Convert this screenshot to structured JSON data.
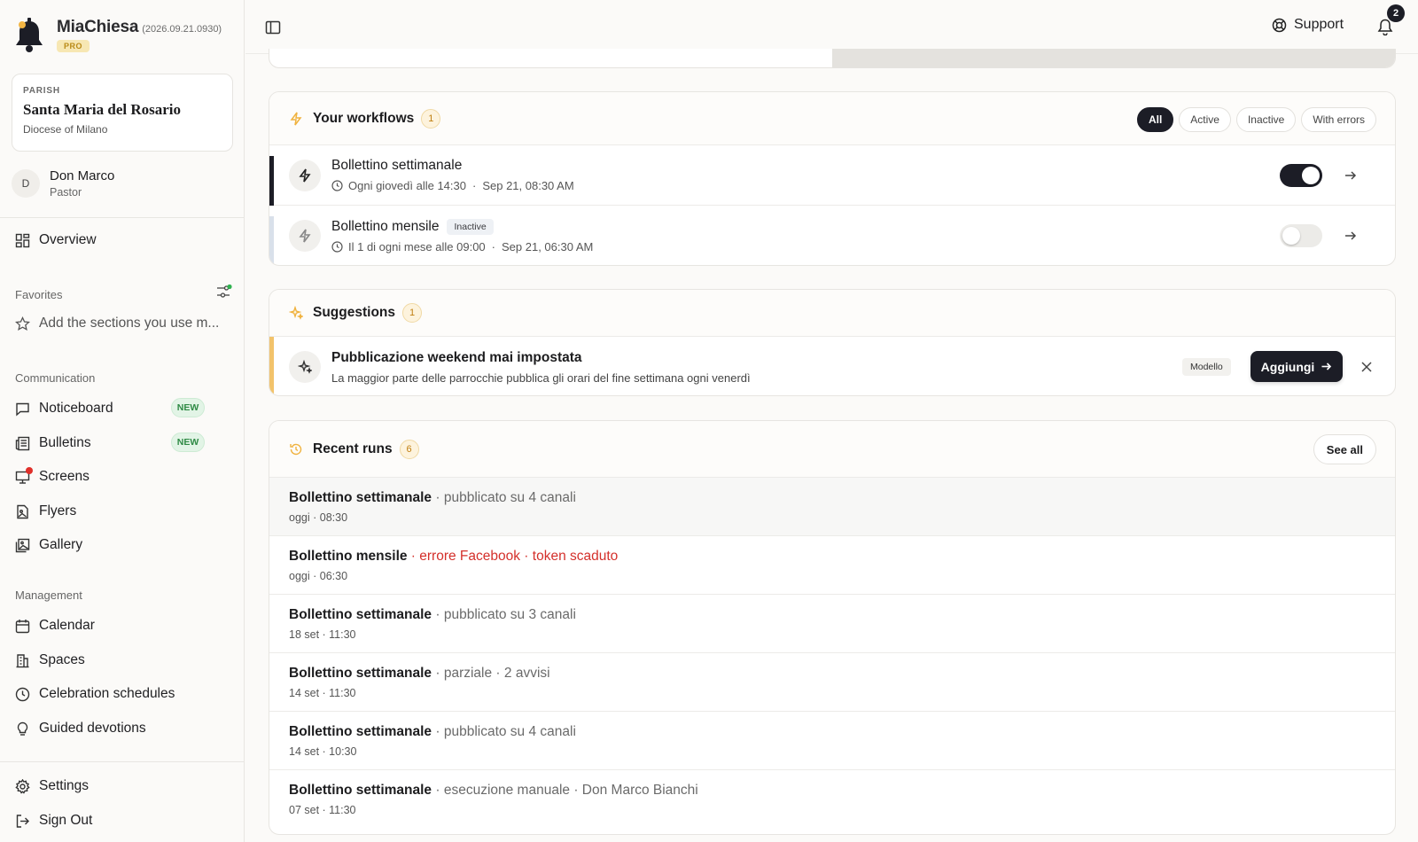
{
  "app": {
    "name": "MiaChiesa",
    "version": "(2026.09.21.0930)",
    "plan": "PRO"
  },
  "parish": {
    "kicker": "PARISH",
    "name": "Santa Maria del Rosario",
    "diocese": "Diocese of Milano"
  },
  "user": {
    "initial": "D",
    "name": "Don Marco",
    "role": "Pastor"
  },
  "nav": {
    "overview": "Overview",
    "favorites_label": "Favorites",
    "favorites_add": "Add the sections you use m...",
    "communication_label": "Communication",
    "noticeboard": "Noticeboard",
    "bulletins": "Bulletins",
    "screens": "Screens",
    "flyers": "Flyers",
    "gallery": "Gallery",
    "new_badge": "NEW",
    "management_label": "Management",
    "calendar": "Calendar",
    "spaces": "Spaces",
    "celebration": "Celebration schedules",
    "devotions": "Guided devotions",
    "settings": "Settings",
    "signout": "Sign Out"
  },
  "topbar": {
    "support": "Support",
    "notifications_count": "2"
  },
  "workflows": {
    "title": "Your workflows",
    "count": "1",
    "filters": [
      "All",
      "Active",
      "Inactive",
      "With errors"
    ],
    "active_filter": "All",
    "items": [
      {
        "name": "Bollettino settimanale",
        "schedule": "Ogni giovedì alle 14:30",
        "last": "Sep 21, 08:30 AM",
        "enabled": true,
        "status_label": ""
      },
      {
        "name": "Bollettino mensile",
        "schedule": "Il 1 di ogni mese alle 09:00",
        "last": "Sep 21, 06:30 AM",
        "enabled": false,
        "status_label": "Inactive"
      }
    ]
  },
  "suggestions": {
    "title": "Suggestions",
    "count": "1",
    "item": {
      "title": "Pubblicazione weekend mai impostata",
      "desc": "La maggior parte delle parrocchie pubblica gli orari del fine settimana ogni venerdì",
      "tag": "Modello",
      "action": "Aggiungi"
    }
  },
  "runs": {
    "title": "Recent runs",
    "count": "6",
    "see_all": "See all",
    "items": [
      {
        "name": "Bollettino settimanale",
        "detail": " · pubblicato su 4 canali",
        "time": "oggi · 08:30",
        "error": false
      },
      {
        "name": "Bollettino mensile",
        "detail": " · errore Facebook · token scaduto",
        "time": "oggi · 06:30",
        "error": true
      },
      {
        "name": "Bollettino settimanale",
        "detail": " · pubblicato su 3 canali",
        "time": "18 set · 11:30",
        "error": false
      },
      {
        "name": "Bollettino settimanale",
        "detail": " · parziale · 2 avvisi",
        "time": "14 set · 11:30",
        "error": false
      },
      {
        "name": "Bollettino settimanale",
        "detail": " · pubblicato su 4 canali",
        "time": "14 set · 10:30",
        "error": false
      },
      {
        "name": "Bollettino settimanale",
        "detail": " · esecuzione manuale · Don Marco Bianchi",
        "time": "07 set · 11:30",
        "error": false
      }
    ]
  },
  "colors": {
    "accent_dark": "#1c1d26",
    "count_bg": "#fdf3dd",
    "suggestion_accent": "#f2c36b",
    "error": "#d4302b",
    "new_green": "#2f8a45"
  },
  "icons": {
    "brand": "bell-icon",
    "panel": "sidebar-toggle-icon",
    "support": "lifebuoy-icon",
    "notifications": "bell-outline-icon",
    "workflow": "bolt-icon",
    "suggestion": "sparkles-icon",
    "runs": "history-icon"
  }
}
